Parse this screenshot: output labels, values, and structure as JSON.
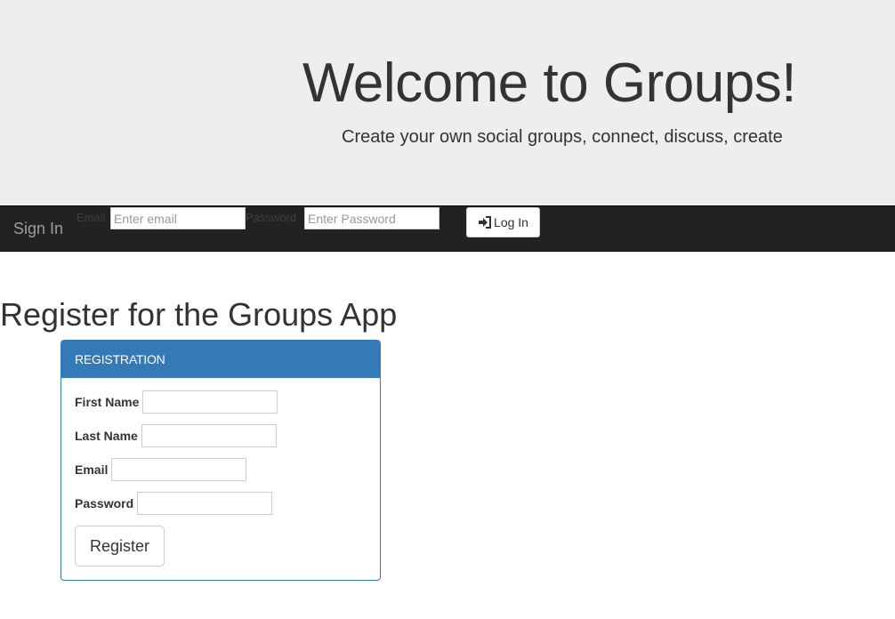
{
  "jumbotron": {
    "title": "Welcome to Groups!",
    "subtitle": "Create your own social groups, connect, discuss, create"
  },
  "navbar": {
    "brand": "Sign In",
    "email_label": "Email",
    "email_placeholder": "Enter email",
    "password_label": "Password",
    "password_placeholder": "Enter Password",
    "login_label": "Log In",
    "login_icon": "log-in-icon"
  },
  "main": {
    "heading": "Register for the Groups App",
    "panel": {
      "title": "REGISTRATION",
      "fields": {
        "first_name": "First Name",
        "last_name": "Last Name",
        "email": "Email",
        "password": "Password"
      },
      "submit_label": "Register"
    }
  },
  "colors": {
    "jumbotron_bg": "#eeeeee",
    "navbar_bg": "#222222",
    "panel_primary": "#337ab7"
  }
}
